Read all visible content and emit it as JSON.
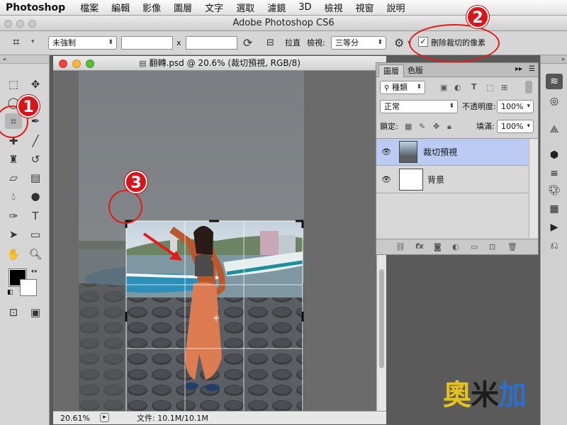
{
  "menubar": {
    "app": "Photoshop",
    "items": [
      "檔案",
      "編輯",
      "影像",
      "圖層",
      "文字",
      "選取",
      "濾鏡",
      "3D",
      "檢視",
      "視窗",
      "說明"
    ]
  },
  "titlebar": {
    "title": "Adobe Photoshop CS6"
  },
  "options": {
    "ratio_select": "未強制",
    "times": "x",
    "straighten": "拉直",
    "view_label": "檢視:",
    "view_select": "三等分",
    "delete_cropped_label": "刪除裁切的像素",
    "delete_cropped_checked": true
  },
  "document": {
    "title": "翻轉.psd @ 20.6% (裁切預視, RGB/8)",
    "zoom": "20.61%",
    "file_info": "文件: 10.1M/10.1M"
  },
  "layers_panel": {
    "tabs": [
      "圖層",
      "色版"
    ],
    "kind_filter": "種類",
    "blend_mode": "正常",
    "opacity_label": "不透明度:",
    "opacity_value": "100%",
    "lock_label": "鎖定:",
    "fill_label": "填滿:",
    "fill_value": "100%",
    "layers": [
      {
        "name": "裁切預視",
        "selected": true
      },
      {
        "name": "背景",
        "selected": false
      }
    ]
  },
  "annotations": [
    "1",
    "2",
    "3"
  ],
  "watermark": "奧米加",
  "colors": {
    "accent": "#d9141b",
    "selected_layer": "#bccbf3",
    "ring": "#e21b1b"
  }
}
